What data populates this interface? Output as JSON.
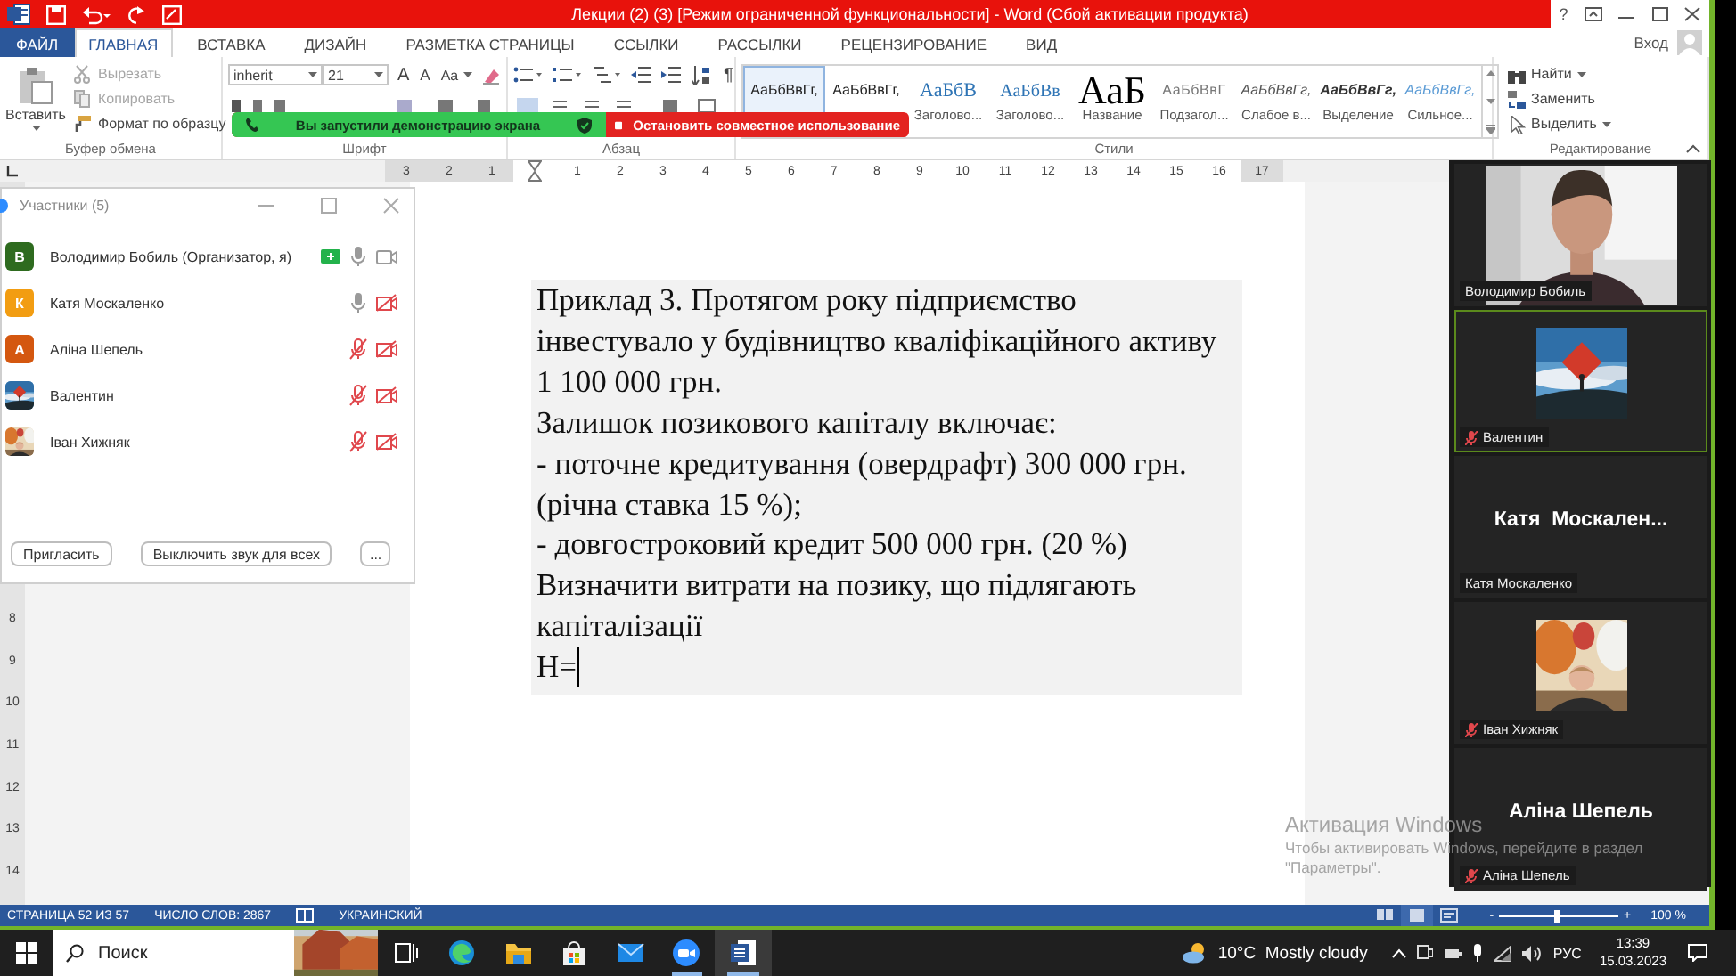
{
  "window": {
    "title": "Лекции (2) (3) [Режим ограниченной функциональности] - Word (Сбой активации продукта)",
    "help": "?",
    "sign_in": "Вход"
  },
  "tabs": [
    {
      "label": "ФАЙЛ",
      "kind": "file",
      "selected": false
    },
    {
      "label": "ГЛАВНАЯ",
      "kind": "tab",
      "selected": true
    },
    {
      "label": "ВСТАВКА",
      "kind": "tab",
      "selected": false
    },
    {
      "label": "ДИЗАЙН",
      "kind": "tab",
      "selected": false
    },
    {
      "label": "РАЗМЕТКА СТРАНИЦЫ",
      "kind": "tab",
      "selected": false
    },
    {
      "label": "ССЫЛКИ",
      "kind": "tab",
      "selected": false
    },
    {
      "label": "РАССЫЛКИ",
      "kind": "tab",
      "selected": false
    },
    {
      "label": "РЕЦЕНЗИРОВАНИЕ",
      "kind": "tab",
      "selected": false
    },
    {
      "label": "ВИД",
      "kind": "tab",
      "selected": false
    }
  ],
  "clipboard": {
    "group": "Буфер обмена",
    "paste": "Вставить",
    "actions": [
      {
        "label": "Вырезать",
        "kind": "cut",
        "disabled": true
      },
      {
        "label": "Копировать",
        "kind": "copy",
        "disabled": true
      },
      {
        "label": "Формат по образцу",
        "kind": "painter",
        "disabled": false
      }
    ]
  },
  "font": {
    "group": "Шрифт",
    "name": "inherit",
    "size": "21",
    "grow": "A",
    "shrink": "A",
    "change_case": "Aa"
  },
  "paragraph": {
    "group": "Абзац",
    "show_marks": "¶"
  },
  "styles": {
    "group": "Стили",
    "items": [
      {
        "sample": "АаБбВвГг,",
        "kind": "normal",
        "selected": true
      },
      {
        "sample": "АаБбВвГг,",
        "kind": "normal",
        "selected": false
      },
      {
        "sample": "АаБбВ",
        "name": "Заголово...",
        "kind": "heading1",
        "selected": false
      },
      {
        "sample": "АаБбВв",
        "name": "Заголово...",
        "kind": "heading2",
        "selected": false
      },
      {
        "sample": "АаБ",
        "name": "Название",
        "kind": "title",
        "selected": false
      },
      {
        "sample": "АаБбВвГ",
        "name": "Подзагол...",
        "kind": "subtitle",
        "selected": false
      },
      {
        "sample": "АаБбВвГг,",
        "name": "Слабое в...",
        "kind": "subtle",
        "selected": false
      },
      {
        "sample": "АаБбВвГг,",
        "name": "Выделение",
        "kind": "emphasis",
        "selected": false
      },
      {
        "sample": "АаБбВвГг,",
        "name": "Сильное...",
        "kind": "intense",
        "selected": false
      }
    ]
  },
  "editing": {
    "group": "Редактирование",
    "actions": [
      {
        "label": "Найти",
        "kind": "find",
        "menu": true
      },
      {
        "label": "Заменить",
        "kind": "replace",
        "menu": false
      },
      {
        "label": "Выделить",
        "kind": "select",
        "menu": true
      }
    ]
  },
  "share_banner": {
    "message": "Вы запустили демонстрацию экрана",
    "stop": "Остановить совместное использование"
  },
  "ruler_marks": {
    "before_indent": [
      "3",
      "2",
      "1"
    ],
    "after_indent": [
      "1",
      "2",
      "3",
      "4",
      "5",
      "6",
      "7",
      "8",
      "9",
      "10",
      "11",
      "12",
      "13",
      "14",
      "15",
      "16",
      "17"
    ],
    "side": [
      "8",
      "9",
      "10",
      "11",
      "12",
      "13",
      "14"
    ]
  },
  "document": {
    "lines": [
      "Приклад 3. Протягом року підприємство",
      "інвестувало у будівництво кваліфікаційного активу",
      "1 100 000 грн.",
      "Залишок позикового капіталу включає:",
      "- поточне кредитування (овердрафт) 300 000 грн.",
      "(річна ставка 15 %);",
      "- довгостроковий кредит 500 000 грн. (20 %)",
      "Визначити витрати на позику, що підлягають",
      "капіталізації",
      "Н="
    ]
  },
  "participants": {
    "title": "Участники (5)",
    "people": [
      {
        "name": "Володимир Бобиль (Организатор, я)",
        "kind": "letter",
        "initial": "В",
        "color": "#2e6b1f",
        "sharing": true,
        "muted": false,
        "video_off": false
      },
      {
        "name": "Катя Москаленко",
        "kind": "letter",
        "initial": "К",
        "color": "#f29d12",
        "sharing": false,
        "muted": false,
        "video_off": true
      },
      {
        "name": "Аліна Шепель",
        "kind": "letter",
        "initial": "А",
        "color": "#d4570f",
        "sharing": false,
        "muted": true,
        "video_off": true
      },
      {
        "name": "Валентин",
        "kind": "picture",
        "sharing": false,
        "muted": true,
        "video_off": true
      },
      {
        "name": "Іван Хижняк",
        "kind": "picture",
        "sharing": false,
        "muted": true,
        "video_off": true
      }
    ],
    "buttons": [
      "Пригласить",
      "Выключить звук для всех",
      "..."
    ]
  },
  "videos": [
    {
      "kind": "camera",
      "name": "Володимир Бобиль",
      "muted": false,
      "active_speaker": false
    },
    {
      "kind": "picture",
      "name": "Валентин",
      "muted": true,
      "active_speaker": true
    },
    {
      "kind": "name",
      "display": "Катя  Москален...",
      "name": "Катя Москаленко",
      "muted": false,
      "active_speaker": false
    },
    {
      "kind": "picture",
      "name": "Іван Хижняк",
      "muted": true,
      "active_speaker": false
    },
    {
      "kind": "name",
      "display": "Аліна Шепель",
      "name": "Аліна Шепель",
      "muted": true,
      "active_speaker": false
    }
  ],
  "status_bar": {
    "page": "СТРАНИЦА 52 ИЗ 57",
    "words": "ЧИСЛО СЛОВ: 2867",
    "language": "УКРАИНСКИЙ",
    "views": [
      {
        "kind": "read",
        "selected": false
      },
      {
        "kind": "print",
        "selected": true
      },
      {
        "kind": "web",
        "selected": false
      }
    ],
    "zoom_out": "-",
    "zoom_in": "+",
    "zoom": {
      "level": 0.48
    },
    "zoom_value": "100 %"
  },
  "activation_notice": {
    "title": "Активация Windows",
    "text": "Чтобы активировать Windows, перейдите в раздел",
    "text_2": "\"Параметры\"."
  },
  "taskbar": {
    "search": {
      "placeholder": "Поиск"
    },
    "apps": [
      {
        "kind": "task_view",
        "running": false,
        "selected": false
      },
      {
        "kind": "edge",
        "running": false,
        "selected": false
      },
      {
        "kind": "explorer",
        "running": false,
        "selected": false
      },
      {
        "kind": "store",
        "running": false,
        "selected": false
      },
      {
        "kind": "mail",
        "running": false,
        "selected": false
      },
      {
        "kind": "zoom",
        "running": true,
        "selected": false
      },
      {
        "kind": "word",
        "running": true,
        "selected": true
      }
    ],
    "weather": "10°C  Mostly cloudy",
    "language": "РУС",
    "time": "13:39",
    "date": "15.03.2023"
  }
}
